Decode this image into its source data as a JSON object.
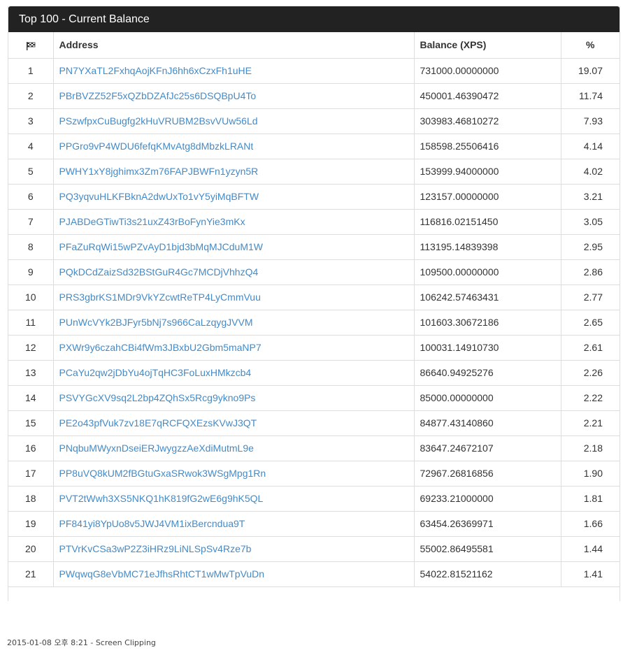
{
  "panel": {
    "title": "Top 100 - Current Balance"
  },
  "table": {
    "columns": {
      "rank_icon": "flag-icon",
      "address": "Address",
      "balance": "Balance (XPS)",
      "percent": "%"
    },
    "rows": [
      {
        "rank": "1",
        "address": "PN7YXaTL2FxhqAojKFnJ6hh6xCzxFh1uHE",
        "balance": "731000.00000000",
        "percent": "19.07"
      },
      {
        "rank": "2",
        "address": "PBrBVZZ52F5xQZbDZAfJc25s6DSQBpU4To",
        "balance": "450001.46390472",
        "percent": "11.74"
      },
      {
        "rank": "3",
        "address": "PSzwfpxCuBugfg2kHuVRUBM2BsvVUw56Ld",
        "balance": "303983.46810272",
        "percent": "7.93"
      },
      {
        "rank": "4",
        "address": "PPGro9vP4WDU6fefqKMvAtg8dMbzkLRANt",
        "balance": "158598.25506416",
        "percent": "4.14"
      },
      {
        "rank": "5",
        "address": "PWHY1xY8jghimx3Zm76FAPJBWFn1yzyn5R",
        "balance": "153999.94000000",
        "percent": "4.02"
      },
      {
        "rank": "6",
        "address": "PQ3yqvuHLKFBknA2dwUxTo1vY5yiMqBFTW",
        "balance": "123157.00000000",
        "percent": "3.21"
      },
      {
        "rank": "7",
        "address": "PJABDeGTiwTi3s21uxZ43rBoFynYie3mKx",
        "balance": "116816.02151450",
        "percent": "3.05"
      },
      {
        "rank": "8",
        "address": "PFaZuRqWi15wPZvAyD1bjd3bMqMJCduM1W",
        "balance": "113195.14839398",
        "percent": "2.95"
      },
      {
        "rank": "9",
        "address": "PQkDCdZaizSd32BStGuR4Gc7MCDjVhhzQ4",
        "balance": "109500.00000000",
        "percent": "2.86"
      },
      {
        "rank": "10",
        "address": "PRS3gbrKS1MDr9VkYZcwtReTP4LyCmmVuu",
        "balance": "106242.57463431",
        "percent": "2.77"
      },
      {
        "rank": "11",
        "address": "PUnWcVYk2BJFyr5bNj7s966CaLzqygJVVM",
        "balance": "101603.30672186",
        "percent": "2.65"
      },
      {
        "rank": "12",
        "address": "PXWr9y6czahCBi4fWm3JBxbU2Gbm5maNP7",
        "balance": "100031.14910730",
        "percent": "2.61"
      },
      {
        "rank": "13",
        "address": "PCaYu2qw2jDbYu4ojTqHC3FoLuxHMkzcb4",
        "balance": "86640.94925276",
        "percent": "2.26"
      },
      {
        "rank": "14",
        "address": "PSVYGcXV9sq2L2bp4ZQhSx5Rcg9ykno9Ps",
        "balance": "85000.00000000",
        "percent": "2.22"
      },
      {
        "rank": "15",
        "address": "PE2o43pfVuk7zv18E7qRCFQXEzsKVwJ3QT",
        "balance": "84877.43140860",
        "percent": "2.21"
      },
      {
        "rank": "16",
        "address": "PNqbuMWyxnDseiERJwygzzAeXdiMutmL9e",
        "balance": "83647.24672107",
        "percent": "2.18"
      },
      {
        "rank": "17",
        "address": "PP8uVQ8kUM2fBGtuGxaSRwok3WSgMpg1Rn",
        "balance": "72967.26816856",
        "percent": "1.90"
      },
      {
        "rank": "18",
        "address": "PVT2tWwh3XS5NKQ1hK819fG2wE6g9hK5QL",
        "balance": "69233.21000000",
        "percent": "1.81"
      },
      {
        "rank": "19",
        "address": "PF841yi8YpUo8v5JWJ4VM1ixBercndua9T",
        "balance": "63454.26369971",
        "percent": "1.66"
      },
      {
        "rank": "20",
        "address": "PTVrKvCSa3wP2Z3iHRz9LiNLSpSv4Rze7b",
        "balance": "55002.86495581",
        "percent": "1.44"
      },
      {
        "rank": "21",
        "address": "PWqwqG8eVbMC71eJfhsRhtCT1wMwTpVuDn",
        "balance": "54022.81521162",
        "percent": "1.41"
      }
    ]
  },
  "caption": "2015-01-08 오후 8:21 - Screen Clipping",
  "colors": {
    "header_bg": "#222222",
    "link": "#428bca",
    "border": "#dddddd"
  }
}
